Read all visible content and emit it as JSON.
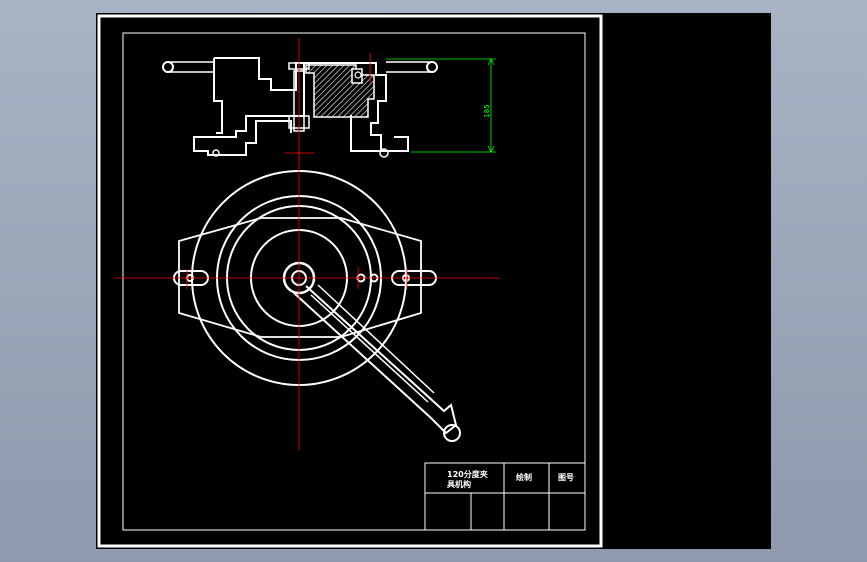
{
  "drawing": {
    "dimension_value": "185",
    "title_block": {
      "name_line1": "120分度夹",
      "name_line2": "具机构",
      "drawn_by_label": "绘制",
      "figure_no_label": "图号"
    }
  },
  "colors": {
    "background": "#000000",
    "outline": "#ffffff",
    "centerline": "#ff0000",
    "dimension": "#00ff00",
    "gutter": "#a9b3c6"
  }
}
